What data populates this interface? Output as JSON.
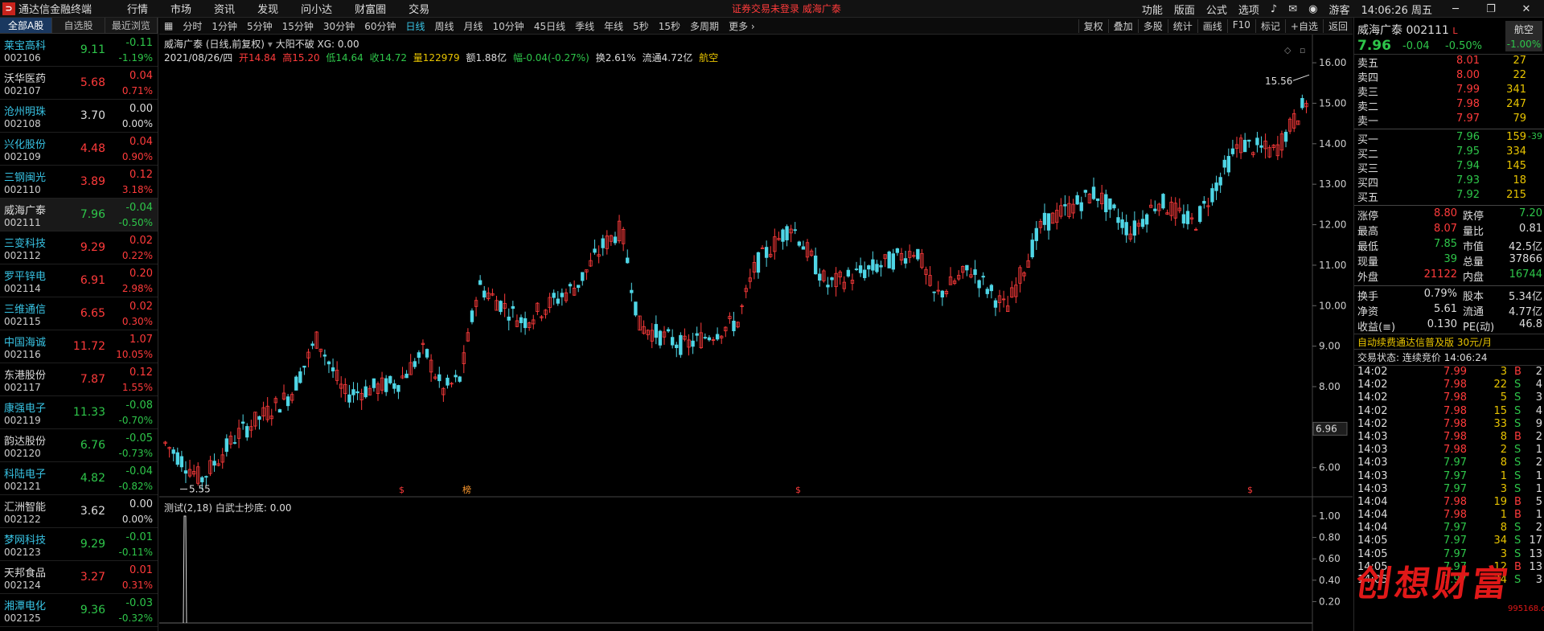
{
  "app": {
    "title": "通达信金融终端",
    "menu": [
      "行情",
      "市场",
      "资讯",
      "发现",
      "问小达",
      "财富圈",
      "交易"
    ],
    "warning": "证券交易未登录  威海广泰",
    "right_menu": [
      "功能",
      "版面",
      "公式",
      "选项"
    ],
    "guest": "游客",
    "clock": "14:06:26 周五"
  },
  "left_tabs": [
    "全部A股",
    "自选股",
    "最近浏览"
  ],
  "stocks": [
    {
      "name": "莱宝高科",
      "code": "002106",
      "price": "9.11",
      "chg": "-0.11",
      "pct": "-1.19%",
      "dir": "dn",
      "nc": "cy"
    },
    {
      "name": "沃华医药",
      "code": "002107",
      "price": "5.68",
      "chg": "0.04",
      "pct": "0.71%",
      "dir": "up",
      "nc": "fl"
    },
    {
      "name": "沧州明珠",
      "code": "002108",
      "price": "3.70",
      "chg": "0.00",
      "pct": "0.00%",
      "dir": "fl",
      "nc": "cy"
    },
    {
      "name": "兴化股份",
      "code": "002109",
      "price": "4.48",
      "chg": "0.04",
      "pct": "0.90%",
      "dir": "up",
      "nc": "cy"
    },
    {
      "name": "三钢闽光",
      "code": "002110",
      "price": "3.89",
      "chg": "0.12",
      "pct": "3.18%",
      "dir": "up",
      "nc": "cy"
    },
    {
      "name": "威海广泰",
      "code": "002111",
      "price": "7.96",
      "chg": "-0.04",
      "pct": "-0.50%",
      "dir": "dn",
      "nc": "fl"
    },
    {
      "name": "三变科技",
      "code": "002112",
      "price": "9.29",
      "chg": "0.02",
      "pct": "0.22%",
      "dir": "up",
      "nc": "cy"
    },
    {
      "name": "罗平锌电",
      "code": "002114",
      "price": "6.91",
      "chg": "0.20",
      "pct": "2.98%",
      "dir": "up",
      "nc": "cy"
    },
    {
      "name": "三维通信",
      "code": "002115",
      "price": "6.65",
      "chg": "0.02",
      "pct": "0.30%",
      "dir": "up",
      "nc": "cy"
    },
    {
      "name": "中国海诚",
      "code": "002116",
      "price": "11.72",
      "chg": "1.07",
      "pct": "10.05%",
      "dir": "up",
      "nc": "cy"
    },
    {
      "name": "东港股份",
      "code": "002117",
      "price": "7.87",
      "chg": "0.12",
      "pct": "1.55%",
      "dir": "up",
      "nc": "fl"
    },
    {
      "name": "康强电子",
      "code": "002119",
      "price": "11.33",
      "chg": "-0.08",
      "pct": "-0.70%",
      "dir": "dn",
      "nc": "cy"
    },
    {
      "name": "韵达股份",
      "code": "002120",
      "price": "6.76",
      "chg": "-0.05",
      "pct": "-0.73%",
      "dir": "dn",
      "nc": "fl"
    },
    {
      "name": "科陆电子",
      "code": "002121",
      "price": "4.82",
      "chg": "-0.04",
      "pct": "-0.82%",
      "dir": "dn",
      "nc": "cy"
    },
    {
      "name": "汇洲智能",
      "code": "002122",
      "price": "3.62",
      "chg": "0.00",
      "pct": "0.00%",
      "dir": "fl",
      "nc": "fl"
    },
    {
      "name": "梦网科技",
      "code": "002123",
      "price": "9.29",
      "chg": "-0.01",
      "pct": "-0.11%",
      "dir": "dn",
      "nc": "cy"
    },
    {
      "name": "天邦食品",
      "code": "002124",
      "price": "3.27",
      "chg": "0.01",
      "pct": "0.31%",
      "dir": "up",
      "nc": "fl"
    },
    {
      "name": "湘潭电化",
      "code": "002125",
      "price": "9.36",
      "chg": "-0.03",
      "pct": "-0.32%",
      "dir": "dn",
      "nc": "cy"
    }
  ],
  "periods": [
    "分时",
    "1分钟",
    "5分钟",
    "15分钟",
    "30分钟",
    "60分钟",
    "日线",
    "周线",
    "月线",
    "10分钟",
    "45日线",
    "季线",
    "年线",
    "5秒",
    "15秒",
    "多周期",
    "更多 ›"
  ],
  "toolbar_right": [
    "复权",
    "叠加",
    "多股",
    "统计",
    "画线",
    "F10",
    "标记",
    "+自选",
    "返回"
  ],
  "chart_header": {
    "title": "威海广泰 (日线,前复权)",
    "indicator": "大阳不破 XG: 0.00"
  },
  "chart_info": {
    "date": "2021/08/26/四",
    "open": "开14.84",
    "high": "高15.20",
    "low": "低14.64",
    "close": "收14.72",
    "vol": "量122979",
    "amt": "额1.88亿",
    "chg": "幅-0.04(-0.27%)",
    "turn": "换2.61%",
    "float": "流通4.72亿",
    "tag": "航空"
  },
  "chart_data": {
    "type": "candlestick",
    "y_ticks": [
      "16.00",
      "15.00",
      "14.00",
      "13.00",
      "12.00",
      "11.00",
      "10.00",
      "9.00",
      "8.00",
      "7.00",
      "6.00"
    ],
    "y_min": 5.3,
    "y_max": 16.2,
    "hi_label": "15.56",
    "lo_label": "5.55",
    "last_label": "6.96",
    "markers": [
      "$",
      "榜",
      "$",
      "$"
    ],
    "sub": {
      "title": "测试(2,18)  白武士抄底: 0.00",
      "y_ticks": [
        "1.00",
        "0.80",
        "0.60",
        "0.40",
        "0.20"
      ]
    }
  },
  "quote": {
    "name": "威海广泰 002111",
    "flag": "L",
    "price": "7.96",
    "chg": "-0.04",
    "pct": "-0.50%",
    "tag": "航空",
    "tag_pct": "-1.00%",
    "asks": [
      {
        "l": "卖五",
        "p": "8.01",
        "v": "27"
      },
      {
        "l": "卖四",
        "p": "8.00",
        "v": "22"
      },
      {
        "l": "卖三",
        "p": "7.99",
        "v": "341"
      },
      {
        "l": "卖二",
        "p": "7.98",
        "v": "247"
      },
      {
        "l": "卖一",
        "p": "7.97",
        "v": "79"
      }
    ],
    "bids": [
      {
        "l": "买一",
        "p": "7.96",
        "v": "159",
        "x": "-39"
      },
      {
        "l": "买二",
        "p": "7.95",
        "v": "334"
      },
      {
        "l": "买三",
        "p": "7.94",
        "v": "145"
      },
      {
        "l": "买四",
        "p": "7.93",
        "v": "18"
      },
      {
        "l": "买五",
        "p": "7.92",
        "v": "215"
      }
    ],
    "stats": [
      [
        "涨停",
        "8.80",
        "up",
        "跌停",
        "7.20",
        "dn"
      ],
      [
        "最高",
        "8.07",
        "up",
        "量比",
        "0.81",
        "fl"
      ],
      [
        "最低",
        "7.85",
        "dn",
        "市值",
        "42.5亿",
        "fl"
      ],
      [
        "现量",
        "39",
        "dn",
        "总量",
        "37866",
        "fl"
      ],
      [
        "外盘",
        "21122",
        "up",
        "内盘",
        "16744",
        "dn"
      ],
      [
        "换手",
        "0.79%",
        "fl",
        "股本",
        "5.34亿",
        "fl"
      ],
      [
        "净资",
        "5.61",
        "fl",
        "流通",
        "4.77亿",
        "fl"
      ],
      [
        "收益(≡)",
        "0.130",
        "fl",
        "PE(动)",
        "46.8",
        "fl"
      ]
    ],
    "ad": "自动续费通达信普及版  30元/月",
    "status": "交易状态: 连续竞价 14:06:24",
    "ticks": [
      [
        "14:02",
        "7.99",
        "3",
        "B",
        "2"
      ],
      [
        "14:02",
        "7.98",
        "22",
        "S",
        "4"
      ],
      [
        "14:02",
        "7.98",
        "5",
        "S",
        "3"
      ],
      [
        "14:02",
        "7.98",
        "15",
        "S",
        "4"
      ],
      [
        "14:02",
        "7.98",
        "33",
        "S",
        "9"
      ],
      [
        "14:03",
        "7.98",
        "8",
        "B",
        "2"
      ],
      [
        "14:03",
        "7.98",
        "2",
        "S",
        "1"
      ],
      [
        "14:03",
        "7.97",
        "8",
        "S",
        "2"
      ],
      [
        "14:03",
        "7.97",
        "1",
        "S",
        "1"
      ],
      [
        "14:03",
        "7.97",
        "3",
        "S",
        "1"
      ],
      [
        "14:04",
        "7.98",
        "19",
        "B",
        "5"
      ],
      [
        "14:04",
        "7.98",
        "1",
        "B",
        "1"
      ],
      [
        "14:04",
        "7.97",
        "8",
        "S",
        "2"
      ],
      [
        "14:05",
        "7.97",
        "34",
        "S",
        "17"
      ],
      [
        "14:05",
        "7.97",
        "3",
        "S",
        "13"
      ],
      [
        "14:05",
        "7.97",
        "12",
        "B",
        "13"
      ],
      [
        "14:05",
        "7.97",
        "34",
        "S",
        "3"
      ]
    ]
  },
  "watermark": "创想财富",
  "watermark_sub": "995168.com"
}
